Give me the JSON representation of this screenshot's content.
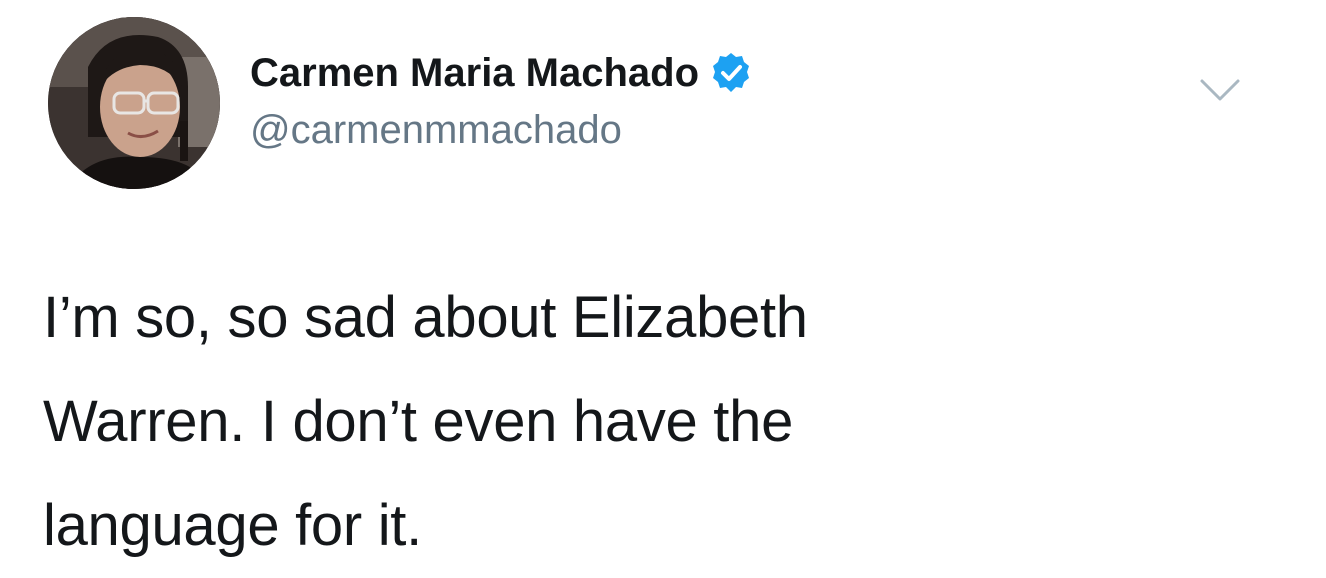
{
  "user": {
    "display_name": "Carmen Maria Machado",
    "handle": "@carmenmmachado",
    "verified": true,
    "avatar_icon": "profile-photo",
    "verified_color": "#1da1f2"
  },
  "menu": {
    "icon": "chevron-down-icon"
  },
  "tweet": {
    "lines": [
      "I’m so, so sad about Elizabeth",
      "Warren. I don’t even have the",
      "language for it."
    ]
  },
  "colors": {
    "text": "#14171a",
    "secondary": "#657786",
    "caret": "#aab8c2"
  }
}
